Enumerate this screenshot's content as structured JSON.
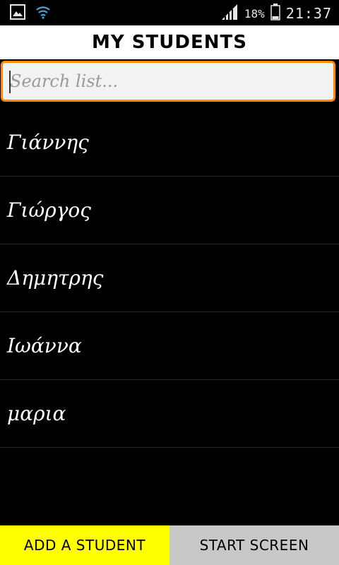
{
  "status_bar": {
    "battery_percent": "18%",
    "time": "21:37",
    "icons": [
      "gallery-icon",
      "wifi-icon",
      "signal-icon",
      "battery-icon"
    ]
  },
  "header": {
    "title": "MY STUDENTS"
  },
  "search": {
    "placeholder": "Search list...",
    "value": ""
  },
  "students": [
    {
      "name": "Γιάννης"
    },
    {
      "name": "Γιώργος"
    },
    {
      "name": "Δημητρης"
    },
    {
      "name": "Ιωάννα"
    },
    {
      "name": "μαρια"
    }
  ],
  "buttons": {
    "add_label": "ADD A STUDENT",
    "start_label": "START SCREEN"
  },
  "colors": {
    "search_border": "#ff8a00",
    "add_button_bg": "#ffff00",
    "start_button_bg": "#c8c8c8"
  }
}
